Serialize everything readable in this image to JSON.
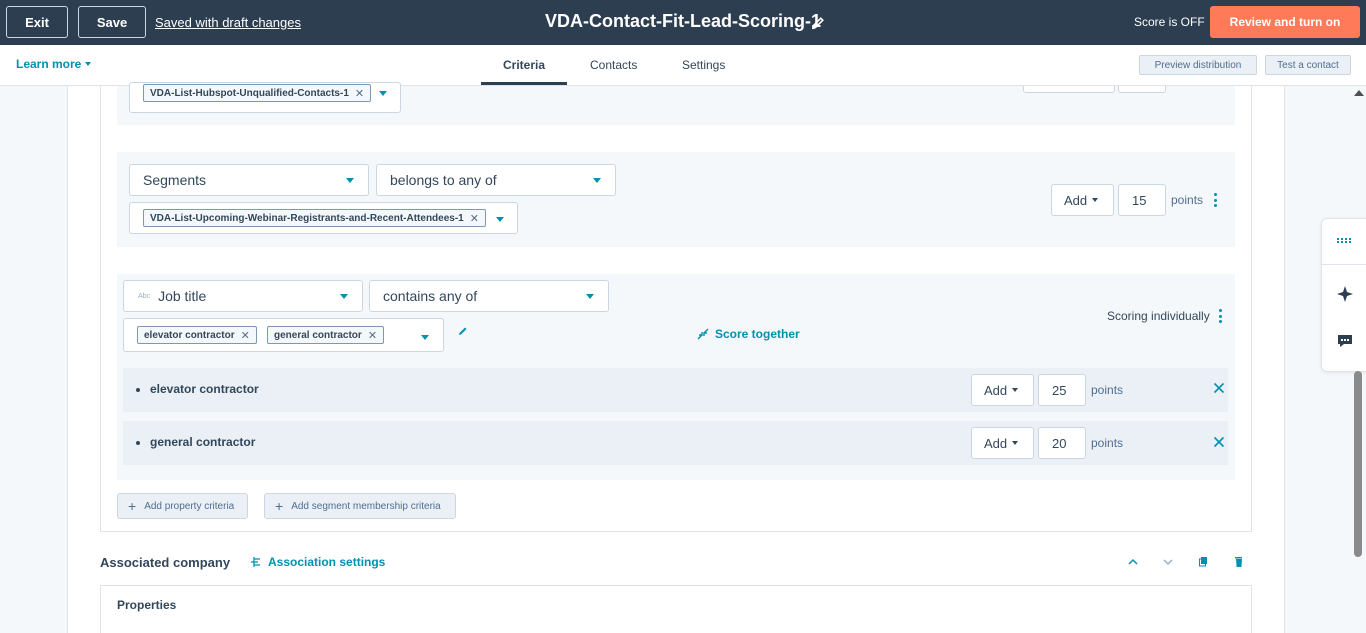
{
  "topbar": {
    "exit_label": "Exit",
    "save_label": "Save",
    "draft_status": "Saved with draft changes",
    "title": "VDA-Contact-Fit-Lead-Scoring-1",
    "score_status": "Score is OFF",
    "review_label": "Review and turn on"
  },
  "tabbar": {
    "learn_more": "Learn more",
    "tabs": [
      {
        "label": "Criteria",
        "active": true
      },
      {
        "label": "Contacts",
        "active": false
      },
      {
        "label": "Settings",
        "active": false
      }
    ],
    "preview_label": "Preview distribution",
    "test_label": "Test a contact"
  },
  "group1": {
    "chips": [
      "VDA-List-Hubspot-Unqualified-Contacts-1"
    ]
  },
  "group2": {
    "property": "Segments",
    "operator": "belongs to any of",
    "chips": [
      "VDA-List-Upcoming-Webinar-Registrants-and-Recent-Attendees-1"
    ],
    "action": "Add",
    "points": "15",
    "points_label": "points"
  },
  "group3": {
    "property_type_icon": "text-type-icon",
    "property": "Job title",
    "operator": "contains any of",
    "chips": [
      "elevator contractor",
      "general contractor"
    ],
    "score_together": "Score together",
    "scoring_mode": "Scoring individually",
    "rows": [
      {
        "label": "elevator contractor",
        "action": "Add",
        "points": "25",
        "points_label": "points"
      },
      {
        "label": "general contractor",
        "action": "Add",
        "points": "20",
        "points_label": "points"
      }
    ]
  },
  "buttons": {
    "add_property": "Add property criteria",
    "add_segment": "Add segment membership criteria"
  },
  "associated": {
    "title": "Associated company",
    "settings_label": "Association settings",
    "properties_title": "Properties"
  },
  "colors": {
    "topbar": "#2d3e50",
    "accent": "#ff7a59",
    "link": "#0091ae"
  }
}
